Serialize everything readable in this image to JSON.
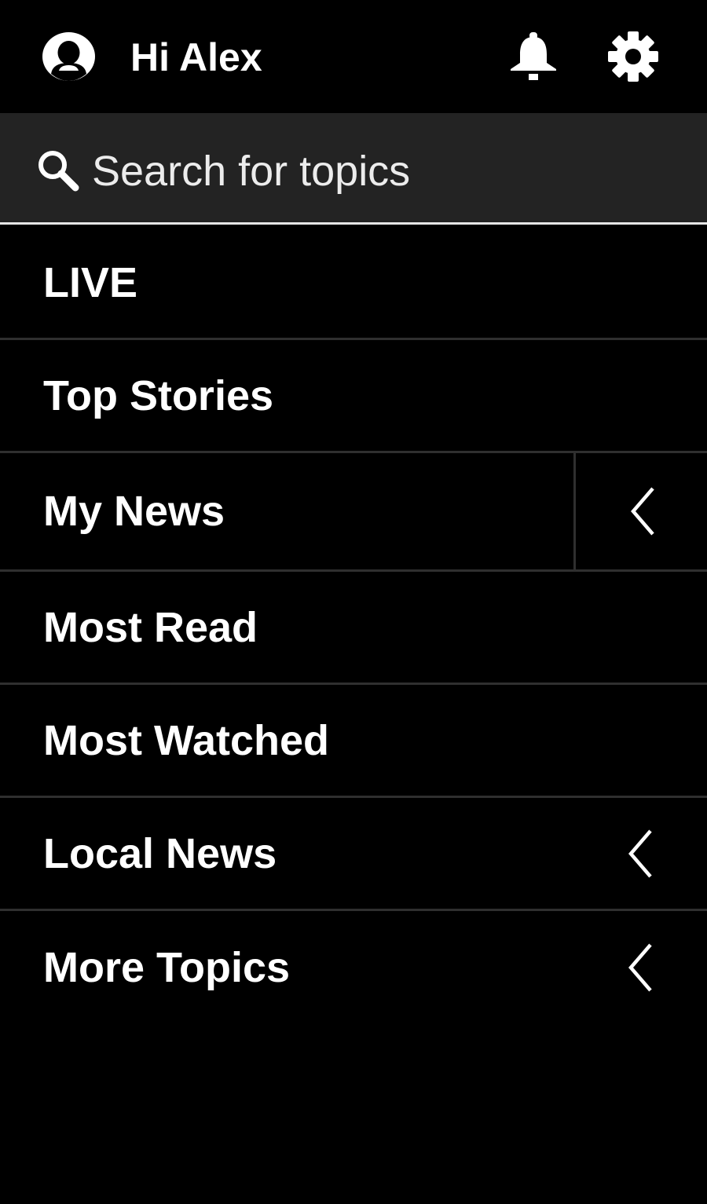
{
  "header": {
    "greeting": "Hi Alex",
    "avatar_icon": "avatar-icon",
    "notifications_icon": "bell-icon",
    "settings_icon": "gear-icon"
  },
  "search": {
    "placeholder": "Search for topics",
    "icon": "search-icon"
  },
  "menu": {
    "items": [
      {
        "label": "LIVE",
        "expandable": false
      },
      {
        "label": "Top Stories",
        "expandable": false
      },
      {
        "label": "My News",
        "expandable": true
      },
      {
        "label": "Most Read",
        "expandable": false
      },
      {
        "label": "Most Watched",
        "expandable": false
      },
      {
        "label": "Local News",
        "expandable": true
      },
      {
        "label": "More Topics",
        "expandable": true
      }
    ]
  },
  "colors": {
    "background": "#000000",
    "search_background": "#232323",
    "divider": "#2f2f2f",
    "text": "#ffffff"
  }
}
